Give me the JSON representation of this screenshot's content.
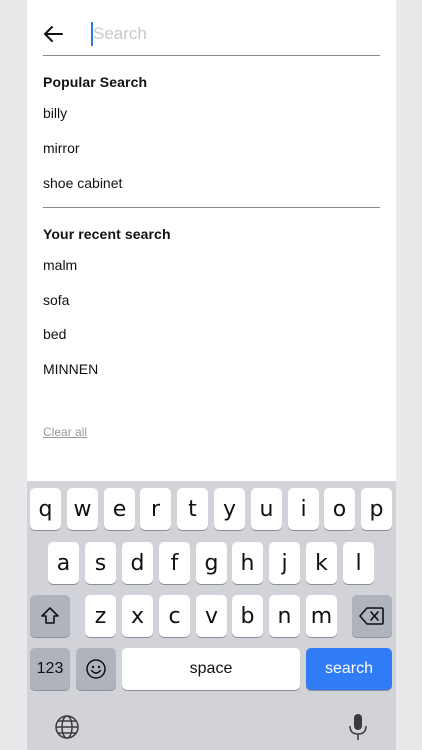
{
  "search": {
    "placeholder": "Search",
    "value": ""
  },
  "popular": {
    "title": "Popular Search",
    "items": [
      "billy",
      "mirror",
      "shoe cabinet"
    ]
  },
  "recent": {
    "title": "Your recent search",
    "items": [
      "malm",
      "sofa",
      "bed",
      "MINNEN"
    ]
  },
  "clear_all": "Clear all",
  "keyboard": {
    "row1": [
      "q",
      "w",
      "e",
      "r",
      "t",
      "y",
      "u",
      "i",
      "o",
      "p"
    ],
    "row2": [
      "a",
      "s",
      "d",
      "f",
      "g",
      "h",
      "j",
      "k",
      "l"
    ],
    "row3": [
      "z",
      "x",
      "c",
      "v",
      "b",
      "n",
      "m"
    ],
    "numbers_label": "123",
    "space_label": "space",
    "search_label": "search"
  },
  "icons": {
    "back": "arrow-left-icon",
    "shift": "shift-icon",
    "delete": "backspace-icon",
    "emoji": "emoji-icon",
    "globe": "globe-icon",
    "mic": "microphone-icon"
  },
  "colors": {
    "accent": "#2f7cf6",
    "keyboard_bg": "#d1d3d9",
    "caret": "#2c7be5"
  }
}
